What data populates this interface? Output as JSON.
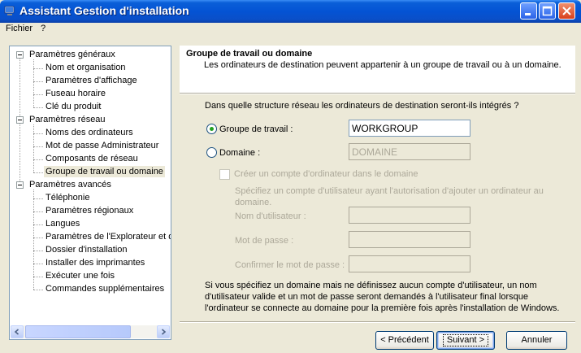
{
  "window": {
    "title": "Assistant Gestion d'installation"
  },
  "menu": {
    "items": [
      "Fichier",
      "?"
    ]
  },
  "tree": {
    "groups": [
      {
        "label": "Paramètres généraux",
        "items": [
          "Nom et organisation",
          "Paramètres d'affichage",
          "Fuseau horaire",
          "Clé du produit"
        ]
      },
      {
        "label": "Paramètres réseau",
        "items": [
          "Noms des ordinateurs",
          "Mot de passe Administrateur",
          "Composants de réseau",
          "Groupe de travail ou domaine"
        ]
      },
      {
        "label": "Paramètres avancés",
        "items": [
          "Téléphonie",
          "Paramètres régionaux",
          "Langues",
          "Paramètres de l'Explorateur et de",
          "Dossier d'installation",
          "Installer des imprimantes",
          "Exécuter une fois",
          "Commandes supplémentaires"
        ]
      }
    ],
    "selected": "Groupe de travail ou domaine"
  },
  "page": {
    "title": "Groupe de travail ou domaine",
    "description": "Les ordinateurs de destination peuvent appartenir à un groupe de travail ou à un domaine.",
    "question": "Dans quelle structure réseau les ordinateurs de destination seront-ils intégrés ?",
    "workgroup": {
      "label": "Groupe de travail :",
      "value": "WORKGROUP",
      "checked": true
    },
    "domain": {
      "label": "Domaine :",
      "value": "DOMAINE",
      "checked": false
    },
    "create_account": {
      "label": "Créer un compte d'ordinateur dans le domaine",
      "checked": false
    },
    "account_desc": "Spécifiez un compte d'utilisateur ayant l'autorisation d'ajouter un ordinateur au domaine.",
    "username_label": "Nom d'utilisateur :",
    "password_label": "Mot de passe :",
    "confirm_label": "Confirmer le mot de passe :",
    "note": "Si vous spécifiez un domaine mais ne définissez aucun compte d'utilisateur, un nom d'utilisateur valide et un mot de passe seront demandés à l'utilisateur final lorsque l'ordinateur se connecte au domaine pour la première fois après l'installation de Windows."
  },
  "buttons": {
    "back": "< Précédent",
    "next": "Suivant >",
    "cancel": "Annuler"
  },
  "icons": [
    "app-icon",
    "minimize-icon",
    "maximize-icon",
    "close-icon",
    "scroll-left-icon",
    "scroll-right-icon"
  ],
  "colors": {
    "titlebar": "#0453d4",
    "window_bg": "#ece9d8",
    "border_blue": "#7f9db9"
  }
}
